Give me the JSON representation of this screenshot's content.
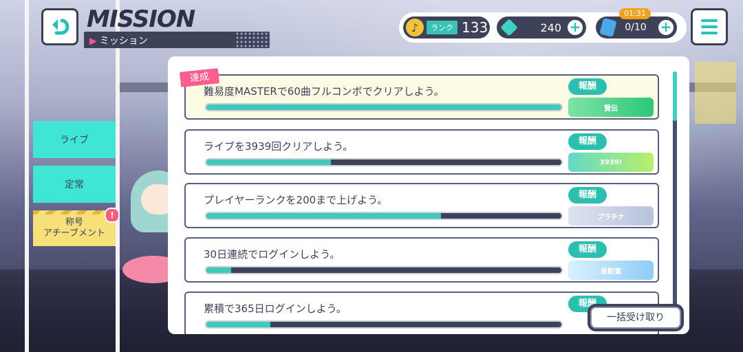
{
  "header": {
    "title": "MISSION",
    "subtitle": "ミッション"
  },
  "status": {
    "rank_label": "ランク",
    "rank_value": "133",
    "crystals": "240",
    "energy": "0/10",
    "energy_timer": "01:31",
    "plus_symbol": "+"
  },
  "sidebar": {
    "tabs": [
      {
        "label": "ライブ"
      },
      {
        "label": "定常"
      },
      {
        "label": "称号\nアチーブメント"
      }
    ],
    "alert_mark": "!"
  },
  "missions": [
    {
      "text": "難易度MASTERで60曲フルコンボでクリアしよう。",
      "progress": 1.0,
      "reward_label": "報酬",
      "reward_item": "賢伝",
      "completed": true
    },
    {
      "text": "ライブを3939回クリアしよう。",
      "progress": 0.35,
      "reward_label": "報酬",
      "reward_item": "3939!",
      "completed": false
    },
    {
      "text": "プレイヤーランクを200まで上げよう。",
      "progress": 0.66,
      "reward_label": "報酬",
      "reward_item": "プラチナ",
      "completed": false
    },
    {
      "text": "30日連続でログインしよう。",
      "progress": 0.07,
      "reward_label": "報酬",
      "reward_item": "皆勤賞",
      "completed": false
    },
    {
      "text": "累積で365日ログインしよう。",
      "progress": 0.18,
      "reward_label": "報酬",
      "reward_item": "",
      "completed": false
    }
  ],
  "done_tag": "達成",
  "claim_all": "一括受け取り",
  "colors": {
    "accent": "#3fc9b9",
    "dark": "#3e4259",
    "pink": "#ff5c8f"
  }
}
